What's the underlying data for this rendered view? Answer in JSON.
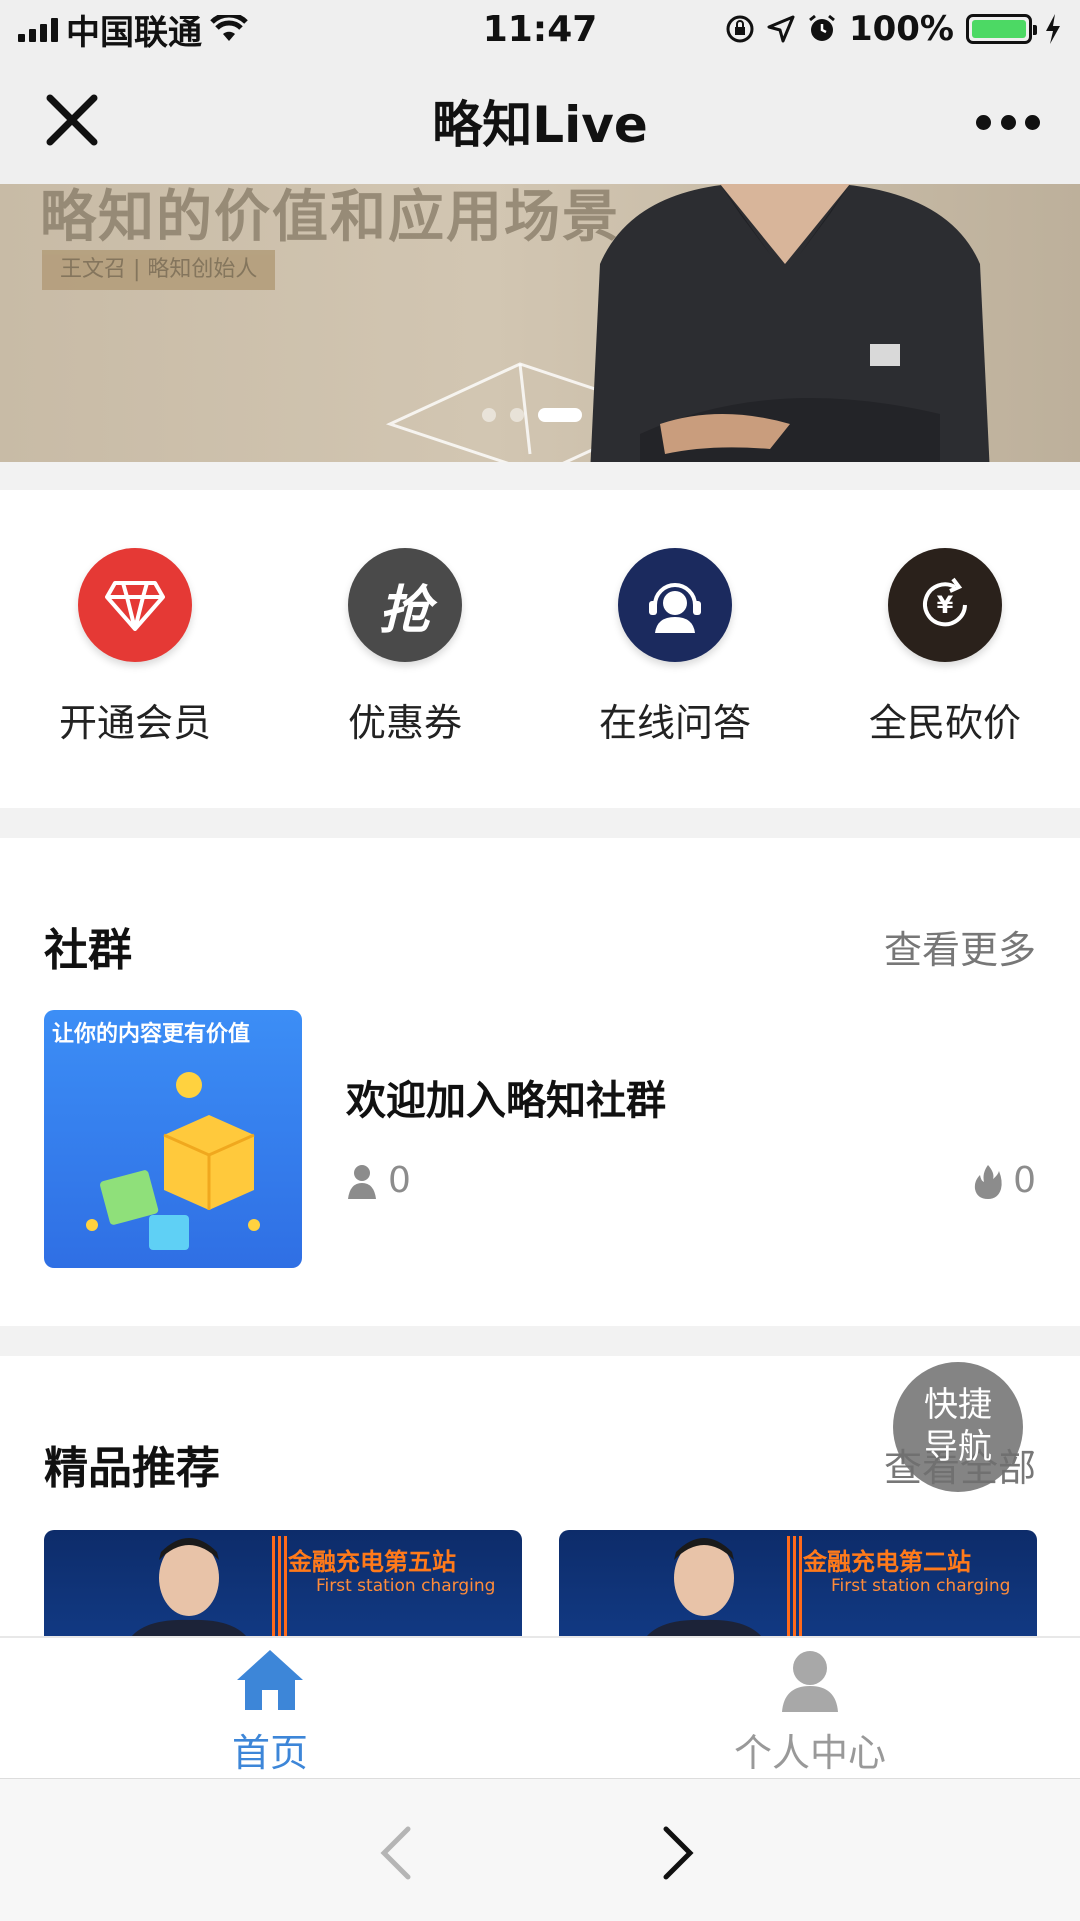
{
  "status_bar": {
    "carrier": "中国联通",
    "time": "11:47",
    "battery": "100%",
    "battery_level": 1.0
  },
  "nav": {
    "title": "略知Live",
    "close_icon": "close-icon",
    "more_icon": "more-icon"
  },
  "banner": {
    "headline": "略知的价值和应用场景",
    "tag": "王文召 | 略知创始人",
    "slide_count": 3,
    "active_slide": 3
  },
  "quick_menu": [
    {
      "label": "开通会员",
      "icon": "diamond-icon",
      "color": "#e53935"
    },
    {
      "label": "优惠券",
      "icon": "grab-coupon-icon",
      "color": "#4a4a4a"
    },
    {
      "label": "在线问答",
      "icon": "headset-support-icon",
      "color": "#1b2a5e"
    },
    {
      "label": "全民砍价",
      "icon": "yuan-refresh-icon",
      "color": "#2a211b"
    }
  ],
  "community": {
    "title": "社群",
    "more": "查看更多",
    "group": {
      "cover_caption": "让你的内容更有价值",
      "name": "欢迎加入略知社群",
      "members": "0",
      "heat": "0"
    }
  },
  "recommend": {
    "title": "精品推荐",
    "more": "查看全部",
    "cards": [
      {
        "title": "金融充电第五站",
        "subtitle": "First station charging"
      },
      {
        "title": "金融充电第二站",
        "subtitle": "First station charging"
      }
    ]
  },
  "fab": {
    "label": "快捷导航"
  },
  "tabs": [
    {
      "label": "首页",
      "icon": "home-icon",
      "active": true
    },
    {
      "label": "个人中心",
      "icon": "person-icon",
      "active": false
    }
  ],
  "colors": {
    "accent": "#3d86d8",
    "status_battery": "#4cd964"
  }
}
